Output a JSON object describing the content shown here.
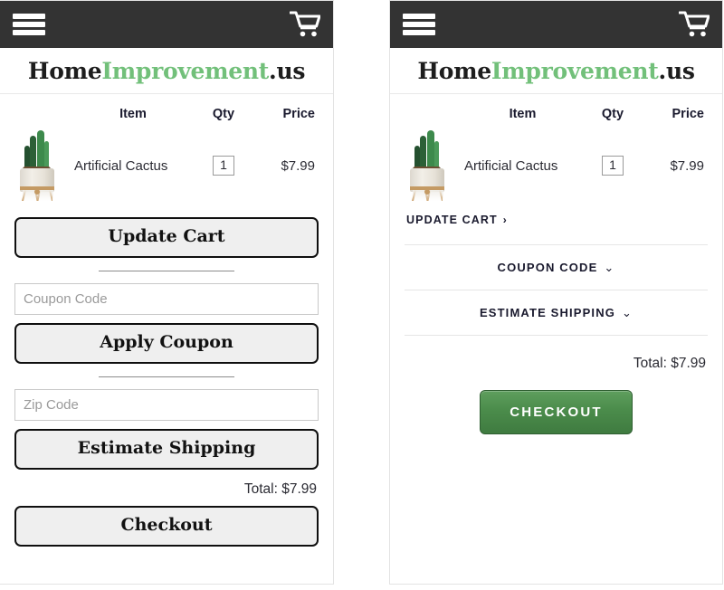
{
  "page": {
    "background": "#ffffff",
    "variants": [
      "cart-variant-plain",
      "cart-variant-accordion"
    ]
  },
  "colors": {
    "topbar": "#333333",
    "brand_green": "#72c07a",
    "brand_dark": "#1d1d1d",
    "checkout_green_top": "#5e9e5d",
    "checkout_green_bottom": "#3f7b40",
    "button_face": "#efefef",
    "button_border": "#0f0f0f",
    "divider": "#e6e6e6"
  },
  "topbar": {
    "menu_icon": "hamburger-menu-icon",
    "cart_icon": "shopping-cart-icon"
  },
  "logo": {
    "part1": "Home",
    "part2": "Improvement",
    "part3": ".us"
  },
  "cart": {
    "headers": {
      "image": "",
      "item": "Item",
      "qty": "Qty",
      "price": "Price"
    },
    "rows": [
      {
        "image_alt": "artificial-cactus-thumbnail",
        "name": "Artificial Cactus",
        "qty": "1",
        "price": "$7.99"
      }
    ],
    "total_label": "Total: $7.99"
  },
  "variant_a": {
    "update_cart_label": "Update Cart",
    "coupon_placeholder": "Coupon Code",
    "coupon_value": "",
    "apply_coupon_label": "Apply Coupon",
    "zip_placeholder": "Zip Code",
    "zip_value": "",
    "estimate_shipping_label": "Estimate Shipping",
    "checkout_label": "Checkout"
  },
  "variant_b": {
    "update_cart_label": "UPDATE CART",
    "update_cart_chevron": "›",
    "coupon_code_label": "COUPON CODE",
    "estimate_shipping_label": "ESTIMATE SHIPPING",
    "chevron_down": "⌄",
    "checkout_label": "CHECKOUT"
  }
}
